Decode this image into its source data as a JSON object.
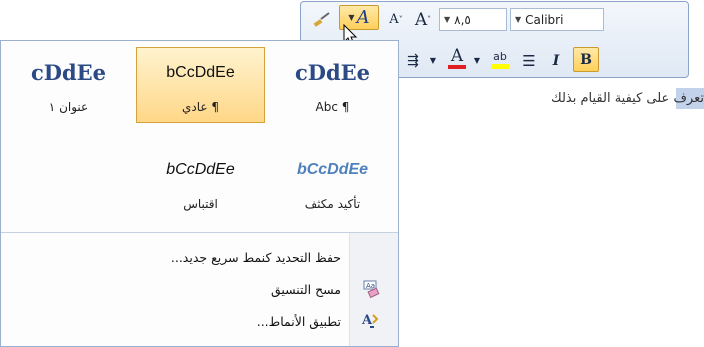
{
  "document": {
    "body_text": "تعرف على كيفية القيام بذلك"
  },
  "mini_toolbar": {
    "font_name": "Calibri",
    "font_size": "٨,٥",
    "grow_font_icon": "A",
    "shrink_font_icon": "A",
    "bold_label": "B",
    "italic_label": "I",
    "font_color_label": "A",
    "highlight_label": "ab"
  },
  "gallery": {
    "styles": [
      {
        "preview": "cDdEe",
        "label": "عنوان ١"
      },
      {
        "preview": "bCcDdEe",
        "label": "¶ عادي"
      },
      {
        "preview": "cDdEe",
        "label": "¶ Abc"
      },
      {
        "preview": "bCcDdEe",
        "label": "اقتباس"
      },
      {
        "preview": "bCcDdEe",
        "label": "تأكيد مكثف"
      }
    ],
    "menu": [
      {
        "label": "حفظ التحديد كنمط سريع جديد..."
      },
      {
        "label": "مسح التنسيق"
      },
      {
        "label": "تطبيق الأنماط..."
      }
    ]
  },
  "colors": {
    "accent": "#2b5797",
    "selected_tile_bg": "#ffd788",
    "font_color_bar": "#e02020",
    "highlight_bar": "#ffff00"
  }
}
